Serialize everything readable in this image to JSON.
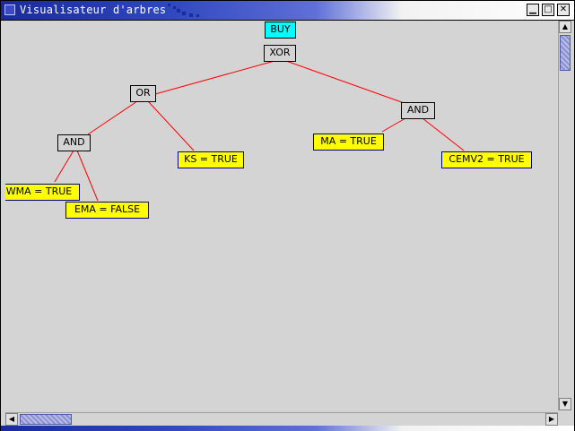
{
  "window": {
    "title": "Visualisateur d'arbres",
    "min_glyph": "▁",
    "max_glyph": "□",
    "close_glyph": "✕"
  },
  "tree": {
    "root_label": "BUY",
    "xor": "XOR",
    "or": "OR",
    "and_left": "AND",
    "and_right": "AND",
    "leaf_wma": "WMA = TRUE",
    "leaf_ema": "EMA = FALSE",
    "leaf_ks": "KS = TRUE",
    "leaf_ma": "MA = TRUE",
    "leaf_cemv2": "CEMV2 = TRUE"
  },
  "scroll": {
    "up": "▲",
    "down": "▼",
    "left": "◀",
    "right": "▶"
  },
  "colors": {
    "edge": "#ff0000",
    "leaf_fill": "#ffff00",
    "root_fill": "#00ffff",
    "canvas_bg": "#d4d4d4"
  }
}
